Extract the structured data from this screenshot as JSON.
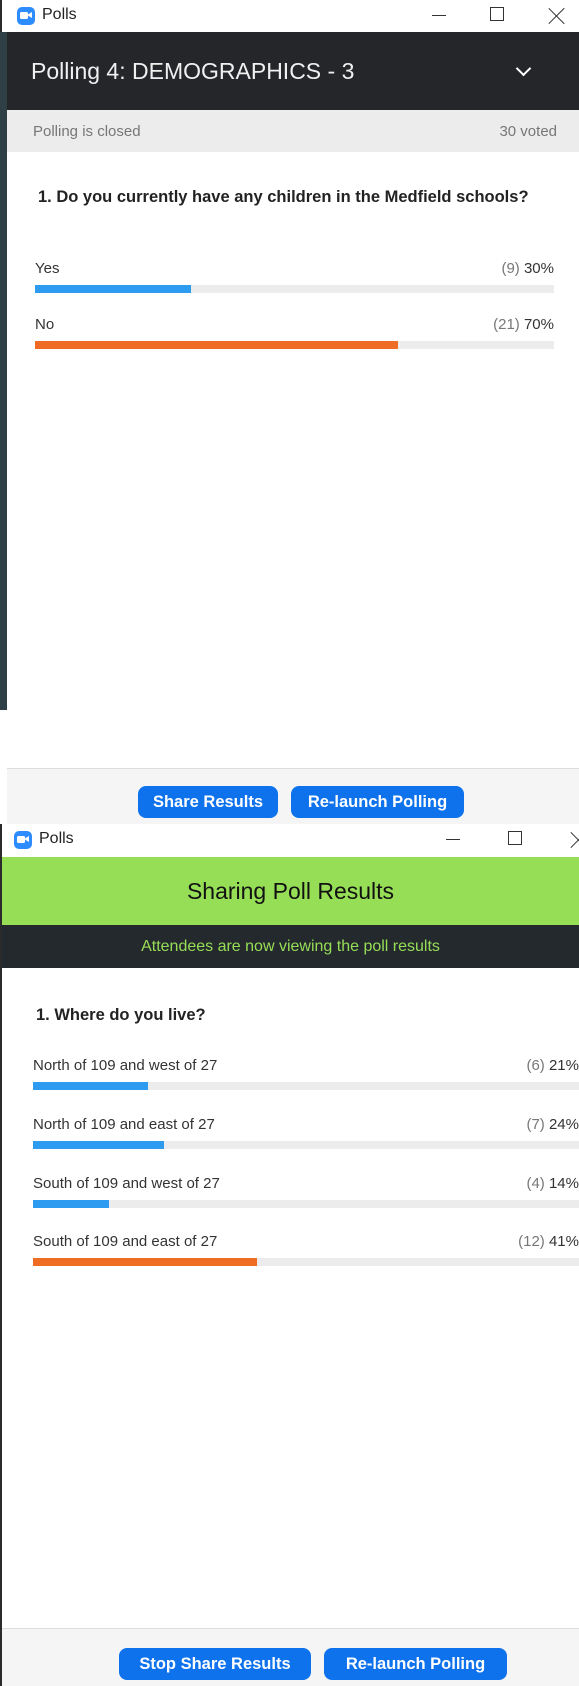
{
  "window1": {
    "title": "Polls",
    "poll_title": "Polling 4: DEMOGRAPHICS - 3",
    "status": "Polling is closed",
    "voted": "30 voted",
    "question": "1. Do you currently have any children in the Medfield schools?",
    "answers": [
      {
        "label": "Yes",
        "count": "(9)",
        "percent": "30%",
        "fraction": 0.3,
        "color": "#2d9bf0"
      },
      {
        "label": "No",
        "count": "(21)",
        "percent": "70%",
        "fraction": 0.7,
        "color": "#ef6c24"
      }
    ],
    "buttons": {
      "share": "Share Results",
      "relaunch": "Re-launch Polling"
    }
  },
  "window2": {
    "title": "Polls",
    "header": "Sharing Poll Results",
    "subheader": "Attendees are now viewing the poll results",
    "question": "1. Where do you live?",
    "answers": [
      {
        "label": "North of 109 and west of 27",
        "count": "(6)",
        "percent": "21%",
        "fraction": 0.21,
        "color": "#2d9bf0"
      },
      {
        "label": "North of 109 and east of 27",
        "count": "(7)",
        "percent": "24%",
        "fraction": 0.24,
        "color": "#2d9bf0"
      },
      {
        "label": "South of 109 and west of 27",
        "count": "(4)",
        "percent": "14%",
        "fraction": 0.14,
        "color": "#2d9bf0"
      },
      {
        "label": "South of 109 and east of 27",
        "count": "(12)",
        "percent": "41%",
        "fraction": 0.41,
        "color": "#ef6c24"
      }
    ],
    "buttons": {
      "stop_share": "Stop Share Results",
      "relaunch": "Re-launch Polling"
    }
  }
}
